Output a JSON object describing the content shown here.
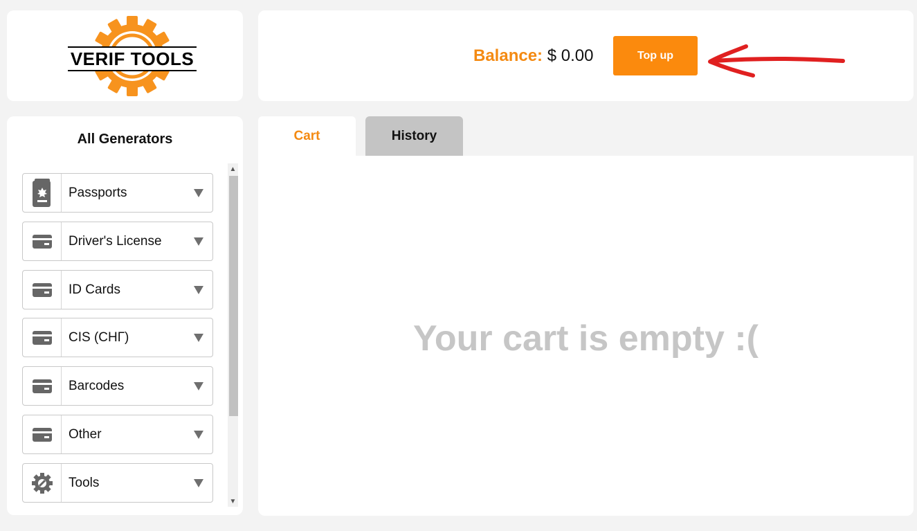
{
  "logo": {
    "text": "VERIF TOOLS",
    "accent_color": "#f7931e"
  },
  "header": {
    "balance_label": "Balance:",
    "balance_value": "$ 0.00",
    "topup_label": "Top up",
    "topup_color": "#fb8a0d",
    "annotation": "red-arrow-pointing-left",
    "annotation_color": "#e02020"
  },
  "sidebar": {
    "title": "All Generators",
    "items": [
      {
        "label": "Passports",
        "icon": "passport-icon"
      },
      {
        "label": "Driver's License",
        "icon": "card-icon"
      },
      {
        "label": "ID Cards",
        "icon": "card-icon"
      },
      {
        "label": "CIS (СНГ)",
        "icon": "card-icon"
      },
      {
        "label": "Barcodes",
        "icon": "card-icon"
      },
      {
        "label": "Other",
        "icon": "card-icon"
      },
      {
        "label": "Tools",
        "icon": "gear-icon"
      }
    ]
  },
  "tabs": [
    {
      "label": "Cart",
      "active": true
    },
    {
      "label": "History",
      "active": false
    }
  ],
  "cart": {
    "empty_message": "Your cart is empty :("
  }
}
